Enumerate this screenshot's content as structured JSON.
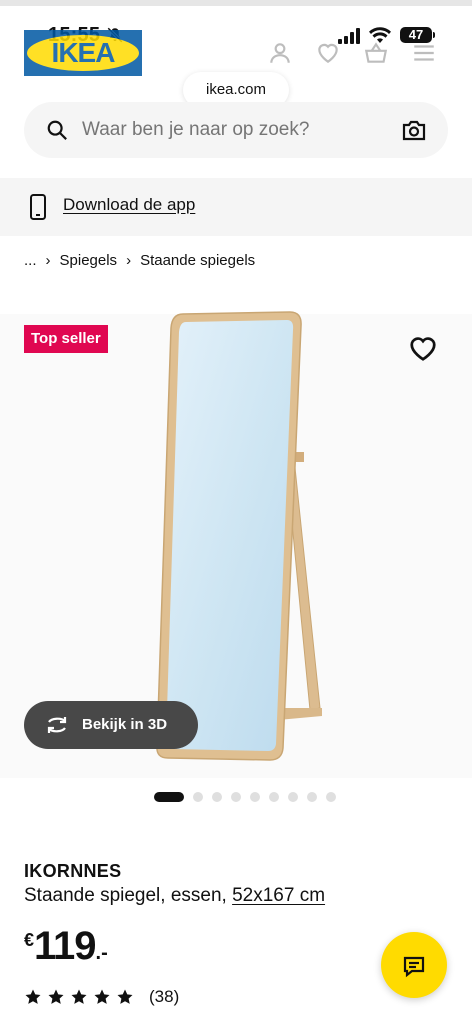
{
  "status": {
    "time": "15:55",
    "battery": "47"
  },
  "header": {
    "logo_text": "IKEA",
    "url": "ikea.com"
  },
  "search": {
    "placeholder": "Waar ben je naar op zoek?"
  },
  "banner": {
    "download_label": "Download de app"
  },
  "breadcrumb": {
    "items": [
      "...",
      "Spiegels",
      "Staande spiegels"
    ]
  },
  "product": {
    "badge": "Top seller",
    "view3d_label": "Bekijk in 3D",
    "image_count": 9,
    "active_image": 1,
    "name": "IKORNNES",
    "description": "Staande spiegel, essen,",
    "size": "52x167 cm",
    "price": {
      "currency": "€",
      "integer": "119",
      "decimal": ".-"
    },
    "rating": 5,
    "reviews": "(38)"
  },
  "colors": {
    "accent_yellow": "#ffdb00",
    "ikea_blue": "#0058a3",
    "badge_red": "#e00751"
  },
  "icons": [
    "bell-slash-icon",
    "signal-icon",
    "wifi-icon",
    "user-icon",
    "heart-icon",
    "basket-icon",
    "menu-icon",
    "search-icon",
    "camera-icon",
    "phone-icon",
    "rotate-3d-icon",
    "star-icon",
    "chat-icon"
  ]
}
